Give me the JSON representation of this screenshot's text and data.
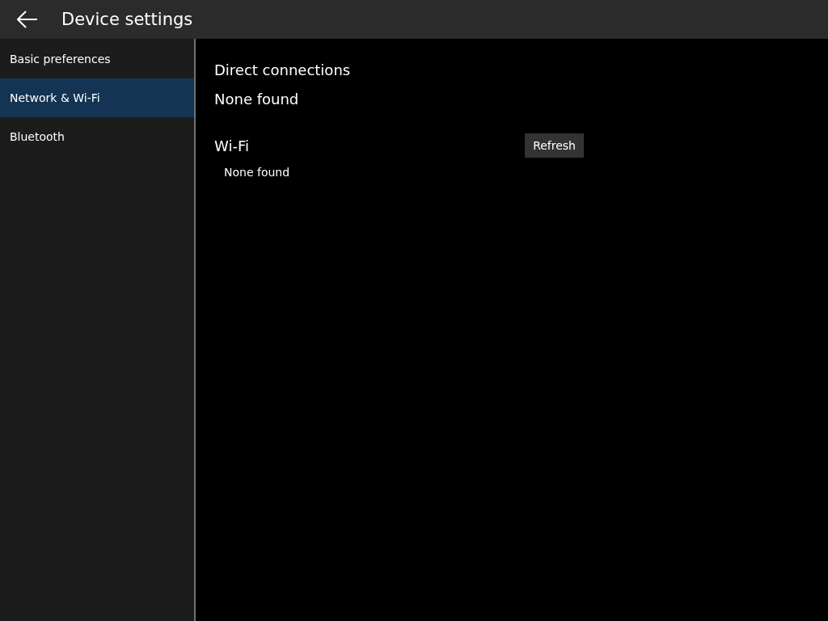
{
  "header": {
    "title": "Device settings"
  },
  "sidebar": {
    "items": [
      {
        "label": "Basic preferences",
        "selected": false
      },
      {
        "label": "Network & Wi-Fi",
        "selected": true
      },
      {
        "label": "Bluetooth",
        "selected": false
      }
    ]
  },
  "direct_connections": {
    "heading": "Direct connections",
    "status": "None found"
  },
  "wifi": {
    "heading": "Wi-Fi",
    "refresh_button": "Refresh",
    "status": "None found"
  }
}
